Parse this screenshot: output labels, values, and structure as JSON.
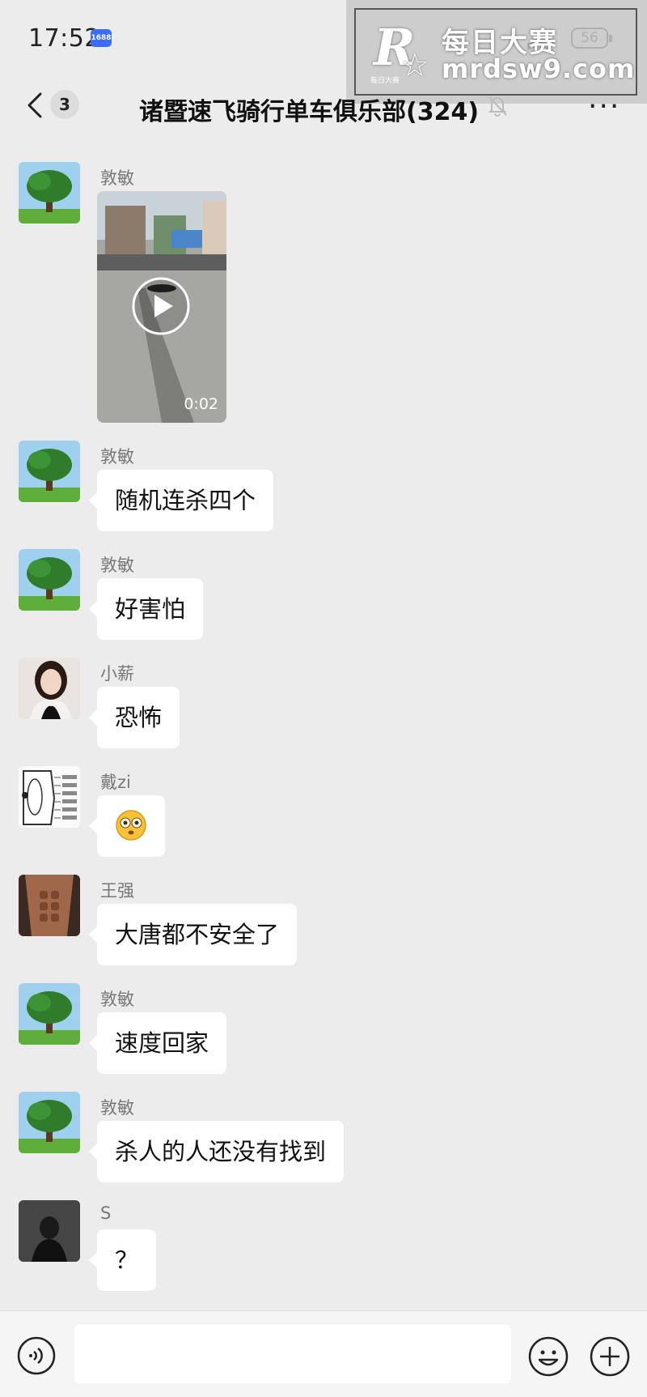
{
  "status_bar": {
    "time": "17:52",
    "app_badge": "1688",
    "battery": "56"
  },
  "watermark": {
    "logo": "R",
    "logo_sub": "每日大赛",
    "text": "每日大赛",
    "url": "mrdsw9.com"
  },
  "header": {
    "unread_count": "3",
    "title": "诸暨速飞骑行单车俱乐部(324)"
  },
  "messages": [
    {
      "sender": "敦敏",
      "type": "video",
      "duration": "0:02"
    },
    {
      "sender": "敦敏",
      "text": "随机连杀四个"
    },
    {
      "sender": "敦敏",
      "text": "好害怕"
    },
    {
      "sender": "小薪",
      "text": "恐怖"
    },
    {
      "sender": "戴zi",
      "type": "emoji",
      "emoji": "flushed-face-emoji"
    },
    {
      "sender": "王强",
      "text": "大唐都不安全了"
    },
    {
      "sender": "敦敏",
      "text": "速度回家"
    },
    {
      "sender": "敦敏",
      "text": "杀人的人还没有找到"
    },
    {
      "sender": "S",
      "text": "？"
    }
  ],
  "input_bar": {
    "placeholder": ""
  },
  "icons": {
    "back": "chevron-left-icon",
    "mute": "bell-slash-icon",
    "more": "more-dots-icon",
    "voice": "voice-icon",
    "emoji": "emoji-icon",
    "plus": "plus-icon"
  }
}
